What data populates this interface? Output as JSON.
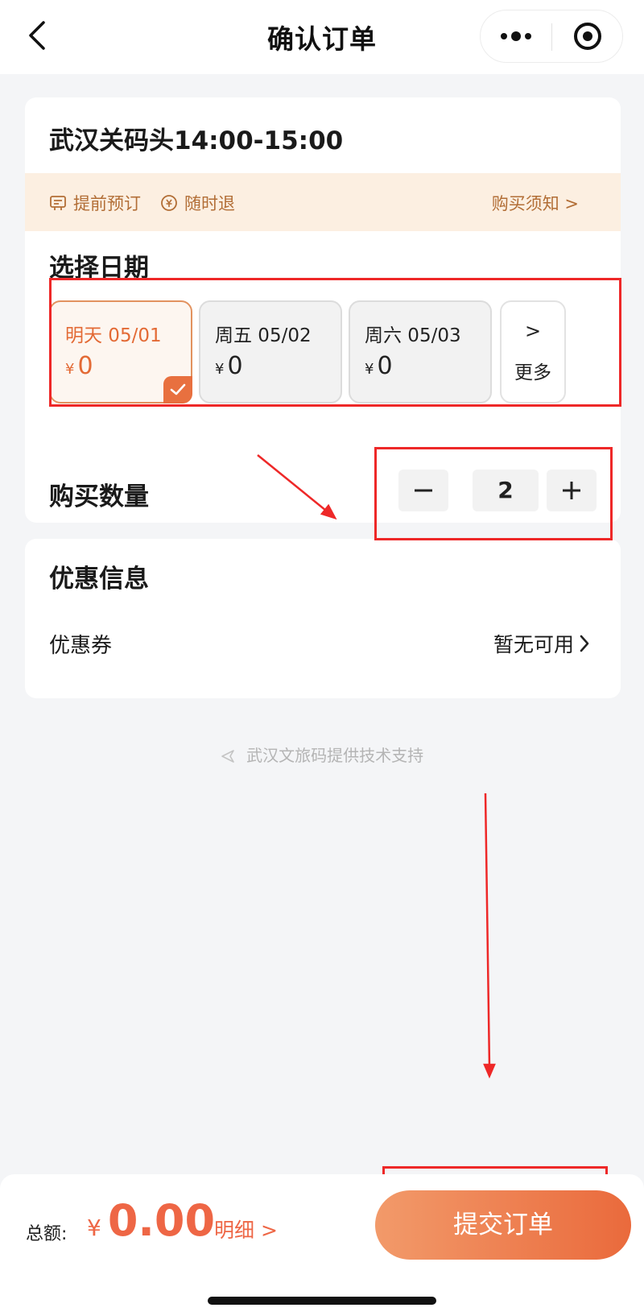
{
  "header": {
    "title": "确认订单",
    "back_icon": "chevron-left-icon",
    "menu_icon": "more-dots-icon",
    "close_icon": "target-icon"
  },
  "ticket": {
    "name": "武汉关码头14:00-15:00",
    "tags": [
      "提前预订",
      "随时退"
    ],
    "notice_link": "购买须知 >"
  },
  "date_section": {
    "label": "选择日期",
    "options": [
      {
        "date": "明天 05/01",
        "currency": "¥",
        "price": "0",
        "selected": true
      },
      {
        "date": "周五 05/02",
        "currency": "¥",
        "price": "0",
        "selected": false
      },
      {
        "date": "周六 05/03",
        "currency": "¥",
        "price": "0",
        "selected": false
      }
    ],
    "more_arrow": ">",
    "more_label": "更多"
  },
  "quantity": {
    "label": "购买数量",
    "value": "2"
  },
  "promo": {
    "title": "优惠信息",
    "coupon_label": "优惠券",
    "coupon_value": "暂无可用"
  },
  "support_text": "武汉文旅码提供技术支持",
  "footer": {
    "total_label": "总额:",
    "currency": "¥",
    "total_amount": "0.00",
    "detail_link": "明细 >",
    "submit_label": "提交订单"
  },
  "colors": {
    "accent": "#e8703f",
    "annotation": "#ee2828",
    "notice_bg": "#fcefe1"
  }
}
